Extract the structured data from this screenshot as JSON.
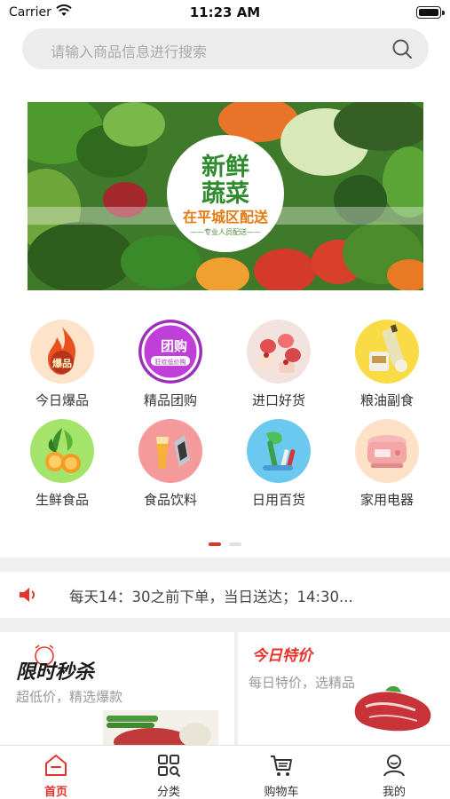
{
  "status_bar": {
    "carrier": "Carrier",
    "time": "11:23 AM"
  },
  "search": {
    "placeholder": "请输入商品信息进行搜索"
  },
  "banner": {
    "title_line1": "新鲜",
    "title_line2": "蔬菜",
    "subtitle": "在平城区配送",
    "tagline": "——专业人员配送——"
  },
  "categories": [
    {
      "label": "今日爆品",
      "icon": "hot-fire-icon",
      "badge": "爆品"
    },
    {
      "label": "精品团购",
      "icon": "group-buy-icon",
      "badge": "团购",
      "badge_sub": "狂欢低价购"
    },
    {
      "label": "进口好货",
      "icon": "imported-desserts-icon"
    },
    {
      "label": "粮油副食",
      "icon": "grain-oil-icon"
    },
    {
      "label": "生鲜食品",
      "icon": "fresh-produce-icon"
    },
    {
      "label": "食品饮料",
      "icon": "food-drink-icon"
    },
    {
      "label": "日用百货",
      "icon": "daily-goods-icon"
    },
    {
      "label": "家用电器",
      "icon": "home-appliance-icon"
    }
  ],
  "carousel": {
    "pages": 2,
    "active_page": 1
  },
  "notice": {
    "text": "每天14：30之前下单，当日送达；14:30..."
  },
  "promos": [
    {
      "title": "限时秒杀",
      "subtitle": "超低价，精选爆款"
    },
    {
      "title": "今日特价",
      "subtitle": "每日特价，选精品"
    }
  ],
  "tabbar": [
    {
      "label": "首页",
      "icon": "home-icon",
      "active": true
    },
    {
      "label": "分类",
      "icon": "category-grid-icon",
      "active": false
    },
    {
      "label": "购物车",
      "icon": "cart-icon",
      "active": false
    },
    {
      "label": "我的",
      "icon": "profile-icon",
      "active": false
    }
  ],
  "colors": {
    "accent": "#e6332a",
    "search_bg": "#ececec",
    "divider": "#efefef"
  }
}
